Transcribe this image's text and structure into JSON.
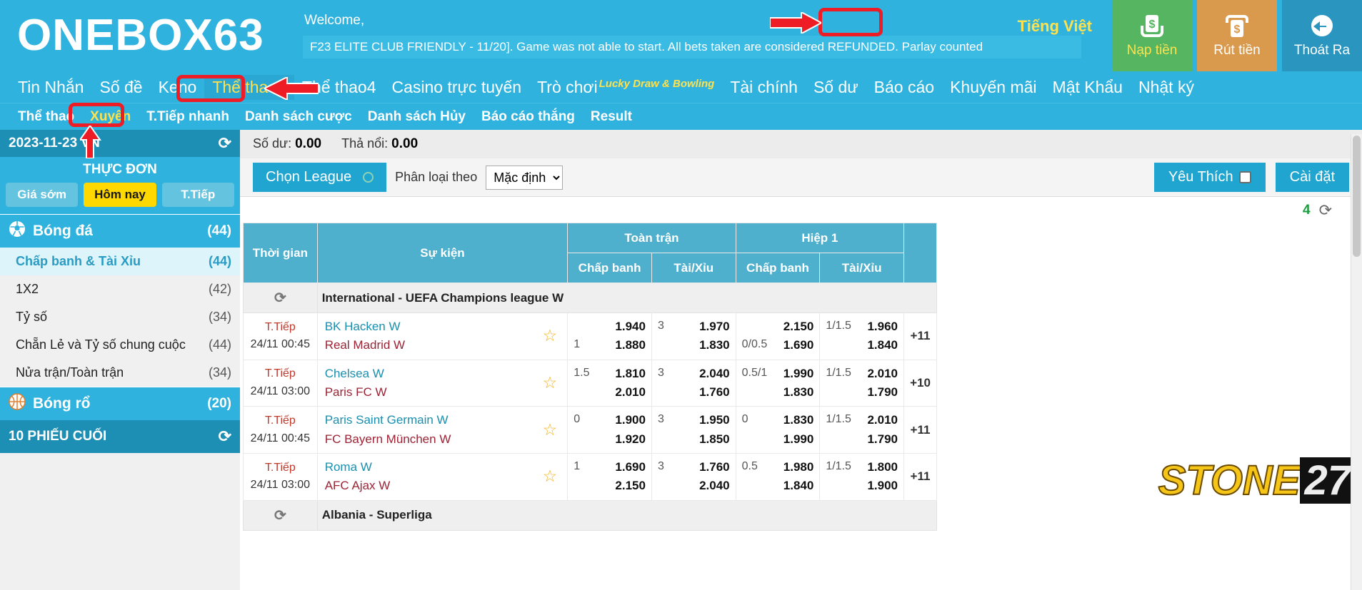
{
  "header": {
    "logo": "ONEBOX63",
    "welcome": "Welcome,",
    "marquee": "F23 ELITE CLUB FRIENDLY - 11/20]. Game was not able to start. All bets taken are considered REFUNDED. Parlay counted",
    "language": "Tiếng Việt",
    "actions": [
      {
        "label": "Nạp tiền",
        "icon": "deposit-money-icon",
        "color": "#55b560"
      },
      {
        "label": "Rút tiền",
        "icon": "withdraw-money-icon",
        "color": "#d99a4e"
      },
      {
        "label": "Thoát Ra",
        "icon": "logout-arrow-icon",
        "color": "#2a96c0"
      }
    ]
  },
  "nav_primary": [
    {
      "label": "Tin Nhắn",
      "active": false
    },
    {
      "label": "Số đề",
      "active": false
    },
    {
      "label": "Keno",
      "active": false
    },
    {
      "label": "Thể thao2",
      "active": true
    },
    {
      "label": "Thể thao4",
      "active": false
    },
    {
      "label": "Casino trực tuyến",
      "active": false
    },
    {
      "label": "Trò chơi",
      "active": false,
      "superscript": "Lucky Draw & Bowling"
    },
    {
      "label": "Tài chính",
      "active": false
    },
    {
      "label": "Số dư",
      "active": false
    },
    {
      "label": "Báo cáo",
      "active": false
    },
    {
      "label": "Khuyến mãi",
      "active": false
    },
    {
      "label": "Mật Khẩu",
      "active": false
    },
    {
      "label": "Nhật ký",
      "active": false
    }
  ],
  "nav_secondary": [
    {
      "label": "Thể thao",
      "active": false
    },
    {
      "label": "Xuyên",
      "active": true
    },
    {
      "label": "T.Tiếp nhanh",
      "active": false
    },
    {
      "label": "Danh sách cược",
      "active": false
    },
    {
      "label": "Danh sách Hủy",
      "active": false
    },
    {
      "label": "Báo cáo thắng",
      "active": false
    },
    {
      "label": "Result",
      "active": false
    }
  ],
  "sidebar": {
    "date": "2023-11-23 VN",
    "menu_title": "THỰC ĐƠN",
    "tabs": [
      {
        "label": "Giá sớm",
        "active": false
      },
      {
        "label": "Hôm nay",
        "active": true
      },
      {
        "label": "T.Tiếp",
        "active": false
      }
    ],
    "groups": [
      {
        "sport": "Bóng đá",
        "icon": "soccer-ball-icon",
        "count": "(44)",
        "items": [
          {
            "label": "Chấp banh & Tài Xỉu",
            "count": "(44)",
            "selected": true
          },
          {
            "label": "1X2",
            "count": "(42)",
            "selected": false
          },
          {
            "label": "Tỷ số",
            "count": "(34)",
            "selected": false
          },
          {
            "label": "Chẵn Lẻ và Tỷ số chung cuộc",
            "count": "(44)",
            "selected": false
          },
          {
            "label": "Nửa trận/Toàn trận",
            "count": "(34)",
            "selected": false
          }
        ]
      },
      {
        "sport": "Bóng rổ",
        "icon": "basketball-icon",
        "count": "(20)",
        "items": []
      }
    ],
    "footer": "10 PHIẾU CUỐI"
  },
  "main": {
    "balance_label": "Số dư:",
    "balance_value": "0.00",
    "float_label": "Thả nổi:",
    "float_value": "0.00",
    "toolbar": {
      "league_button": "Chọn League",
      "sort_label": "Phân loại theo",
      "sort_value": "Mặc định",
      "sort_options": [
        "Mặc định"
      ],
      "favorite_button": "Yêu Thích",
      "settings_button": "Cài đặt"
    },
    "refresh_count": "4",
    "table": {
      "headers": {
        "time": "Thời gian",
        "event": "Sự kiện",
        "full_match": "Toàn trận",
        "first_half": "Hiệp 1",
        "handicap": "Chấp banh",
        "over_under": "Tài/Xỉu"
      },
      "leagues": [
        {
          "name": "International - UEFA Champions league W",
          "matches": [
            {
              "status": "T.Tiếp",
              "datetime": "24/11 00:45",
              "home": "BK Hacken W",
              "away": "Real Madrid W",
              "ft_hdp_line_home": "",
              "ft_hdp_odd_home": "1.940",
              "ft_hdp_line_away": "1",
              "ft_hdp_odd_away": "1.880",
              "ft_ou_line_home": "3",
              "ft_ou_odd_home": "1.970",
              "ft_ou_line_away": "",
              "ft_ou_odd_away": "1.830",
              "h1_hdp_line_home": "",
              "h1_hdp_odd_home": "2.150",
              "h1_hdp_line_away": "0/0.5",
              "h1_hdp_odd_away": "1.690",
              "h1_ou_line_home": "1/1.5",
              "h1_ou_odd_home": "1.960",
              "h1_ou_line_away": "",
              "h1_ou_odd_away": "1.840",
              "more": "+11"
            },
            {
              "status": "T.Tiếp",
              "datetime": "24/11 03:00",
              "home": "Chelsea W",
              "away": "Paris FC W",
              "ft_hdp_line_home": "1.5",
              "ft_hdp_odd_home": "1.810",
              "ft_hdp_line_away": "",
              "ft_hdp_odd_away": "2.010",
              "ft_ou_line_home": "3",
              "ft_ou_odd_home": "2.040",
              "ft_ou_line_away": "",
              "ft_ou_odd_away": "1.760",
              "h1_hdp_line_home": "0.5/1",
              "h1_hdp_odd_home": "1.990",
              "h1_hdp_line_away": "",
              "h1_hdp_odd_away": "1.830",
              "h1_ou_line_home": "1/1.5",
              "h1_ou_odd_home": "2.010",
              "h1_ou_line_away": "",
              "h1_ou_odd_away": "1.790",
              "more": "+10"
            },
            {
              "status": "T.Tiếp",
              "datetime": "24/11 00:45",
              "home": "Paris Saint Germain W",
              "away": "FC Bayern München W",
              "ft_hdp_line_home": "0",
              "ft_hdp_odd_home": "1.900",
              "ft_hdp_line_away": "",
              "ft_hdp_odd_away": "1.920",
              "ft_ou_line_home": "3",
              "ft_ou_odd_home": "1.950",
              "ft_ou_line_away": "",
              "ft_ou_odd_away": "1.850",
              "h1_hdp_line_home": "0",
              "h1_hdp_odd_home": "1.830",
              "h1_hdp_line_away": "",
              "h1_hdp_odd_away": "1.990",
              "h1_ou_line_home": "1/1.5",
              "h1_ou_odd_home": "2.010",
              "h1_ou_line_away": "",
              "h1_ou_odd_away": "1.790",
              "more": "+11"
            },
            {
              "status": "T.Tiếp",
              "datetime": "24/11 03:00",
              "home": "Roma W",
              "away": "AFC Ajax W",
              "ft_hdp_line_home": "1",
              "ft_hdp_odd_home": "1.690",
              "ft_hdp_line_away": "",
              "ft_hdp_odd_away": "2.150",
              "ft_ou_line_home": "3",
              "ft_ou_odd_home": "1.760",
              "ft_ou_line_away": "",
              "ft_ou_odd_away": "2.040",
              "h1_hdp_line_home": "0.5",
              "h1_hdp_odd_home": "1.980",
              "h1_hdp_line_away": "",
              "h1_hdp_odd_away": "1.840",
              "h1_ou_line_home": "1/1.5",
              "h1_ou_odd_home": "1.800",
              "h1_ou_line_away": "",
              "h1_ou_odd_away": "1.900",
              "more": "+11"
            }
          ]
        },
        {
          "name": "Albania - Superliga",
          "matches": []
        }
      ]
    }
  },
  "watermark": {
    "part1": "STONE",
    "part2": "27"
  },
  "annotations": {
    "language_highlight": "red-box-around-tieng-viet",
    "arrow_to_language": "red-arrow-left",
    "thethao2_highlight": "red-box-around-the-thao2",
    "arrow_to_thethao2": "red-arrow-left",
    "xuyen_highlight": "red-box-around-xuyen",
    "arrow_to_xuyen": "red-arrow-up"
  }
}
